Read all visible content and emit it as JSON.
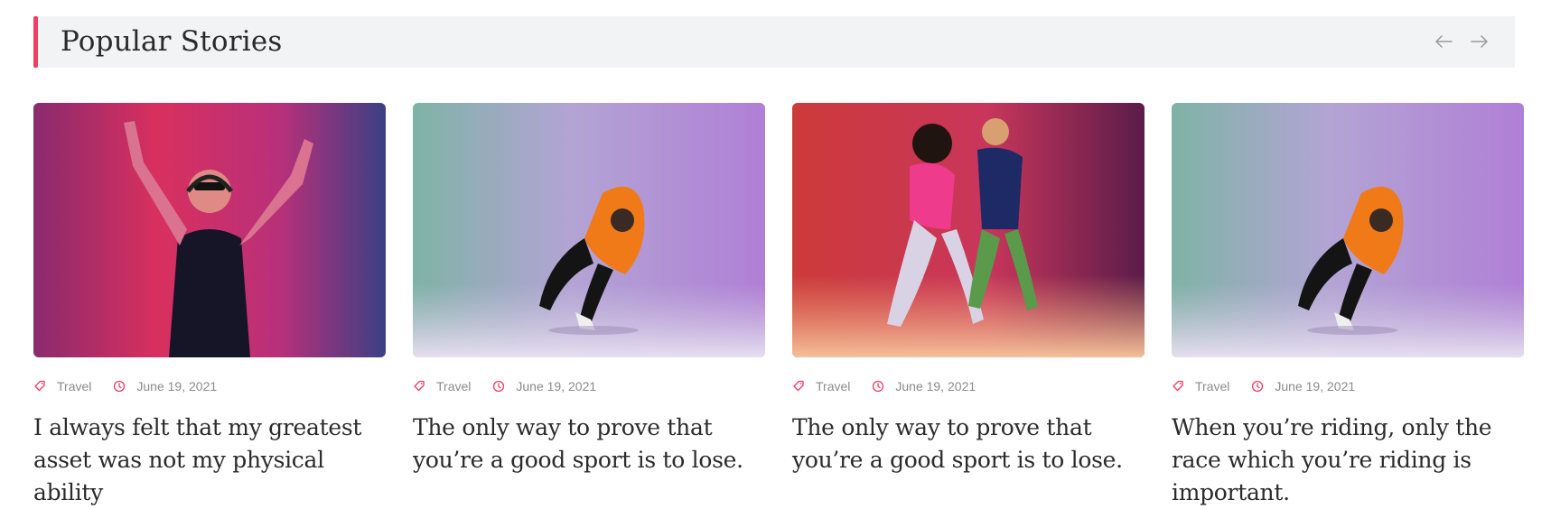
{
  "section": {
    "title": "Popular Stories",
    "accent_color": "#ef3d63",
    "prev_icon": "arrow-left-icon",
    "next_icon": "arrow-right-icon"
  },
  "cards": [
    {
      "image_desc": "man with headphones raising arms, pink-purple neon",
      "category": "Travel",
      "date": "June 19, 2021",
      "headline": "I always felt that my greatest asset was not my physical ability"
    },
    {
      "image_desc": "dancer in orange hoodie, teal-to-violet background",
      "category": "Travel",
      "date": "June 19, 2021",
      "headline": "The only way to prove that you’re a good sport is to lose."
    },
    {
      "image_desc": "two dancers, red-to-purple neon background",
      "category": "Travel",
      "date": "June 19, 2021",
      "headline": "The only way to prove that you’re a good sport is to lose."
    },
    {
      "image_desc": "dancer in orange hoodie, teal-to-violet background",
      "category": "Travel",
      "date": "June 19, 2021",
      "headline": "When you’re riding, only the race which you’re riding is important."
    }
  ]
}
